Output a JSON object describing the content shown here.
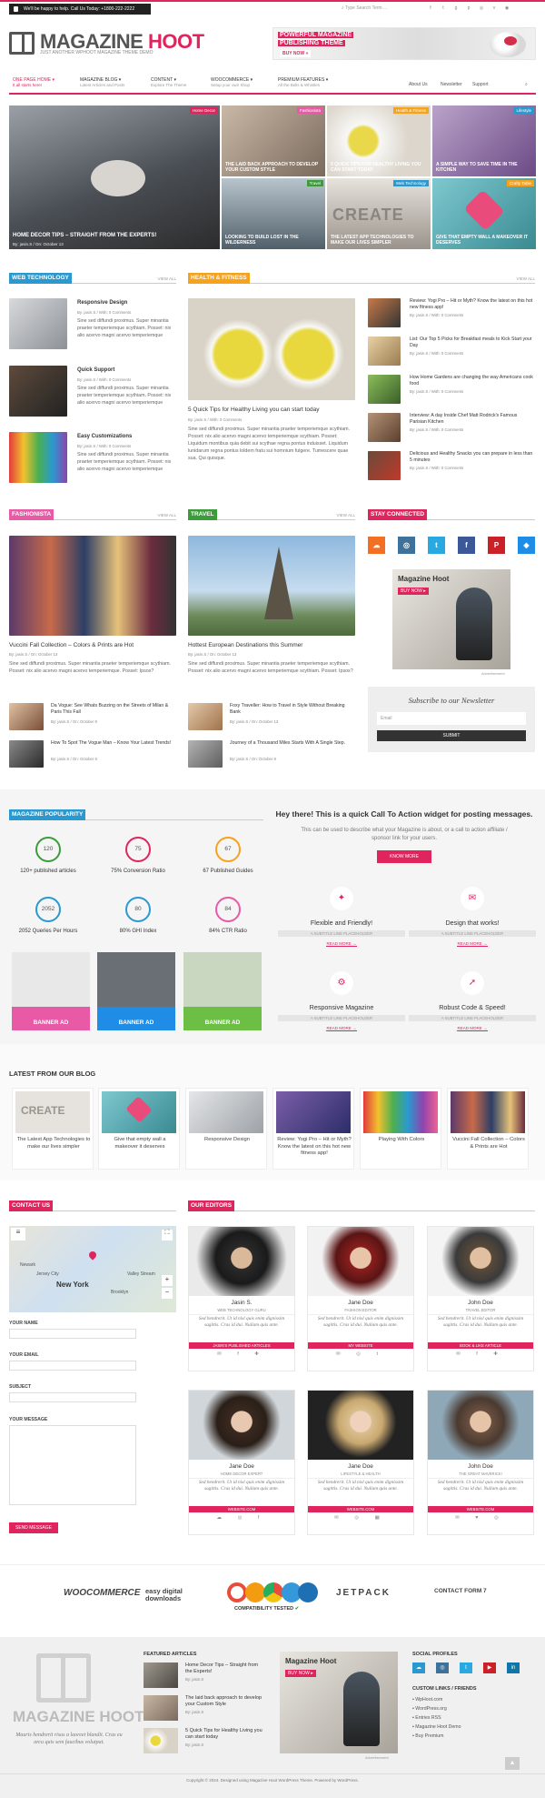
{
  "topbar": {
    "callout": "We'll be happy to help. Call Us Today: +1800-222-2222",
    "search_placeholder": "Type Search Term ...",
    "social_icons": [
      "facebook-icon",
      "twitter-icon",
      "google-plus-icon",
      "pinterest-icon",
      "instagram-icon",
      "vimeo-icon",
      "rss-icon"
    ]
  },
  "brand": {
    "name_first": "MAGAZINE",
    "name_second": "HOOT",
    "tagline": "JUST ANOTHER WPHOOT MAGAZINE THEME DEMO",
    "accent": "#e0245e"
  },
  "header_banner": {
    "line1": "POWERFUL MAGAZINE",
    "line2": "PUBLISHING THEME",
    "button": "BUY NOW »"
  },
  "nav": {
    "items": [
      {
        "label": "ONE PAGE HOME ▾",
        "sub": "It all starts here!"
      },
      {
        "label": "MAGAZINE BLOG ▾",
        "sub": "Latest Articles and Posts"
      },
      {
        "label": "CONTENT ▾",
        "sub": "Explore The Theme"
      },
      {
        "label": "WOOCOMMERCE ▾",
        "sub": "Setup your own Shop"
      },
      {
        "label": "PREMIUM FEATURES ▾",
        "sub": "All the Bells & Whistles"
      }
    ],
    "right": [
      "About Us",
      "Newsletter",
      "Support"
    ]
  },
  "hero": {
    "tiles": [
      {
        "cat": "Home Decor",
        "title": "HOME DECOR TIPS – STRAIGHT FROM THE EXPERTS!",
        "meta": "By: jasin.S  /  On: October 13",
        "color": "#e0245e"
      },
      {
        "cat": "Fashionista",
        "title": "THE LAID BACK APPROACH TO DEVELOP YOUR CUSTOM STYLE",
        "meta": "",
        "color": "#e85aa6"
      },
      {
        "cat": "Health & Fitness",
        "title": "5 QUICK TIPS FOR HEALTHY LIVING YOU CAN START TODAY",
        "meta": "",
        "color": "#f7a21b"
      },
      {
        "cat": "Lifestyle",
        "title": "A SIMPLE WAY TO SAVE TIME IN THE KITCHEN",
        "meta": "",
        "color": "#2a99d0"
      },
      {
        "cat": "Travel",
        "title": "LOOKING TO BUILD LOST IN THE WILDERNESS",
        "meta": "",
        "color": "#3a9d3a"
      },
      {
        "cat": "Web Technology",
        "title": "THE LATEST APP TECHNOLOGIES TO MAKE OUR LIVES SIMPLER",
        "meta": "",
        "color": "#2a99d0"
      },
      {
        "cat": "Crafty Table",
        "title": "GIVE THAT EMPTY WALL A MAKEOVER IT DESERVES",
        "meta": "",
        "color": "#f7a21b"
      }
    ]
  },
  "web_tech": {
    "label": "WEB TECHNOLOGY",
    "view_all": "VIEW ALL",
    "color": "#2a99d0",
    "posts": [
      {
        "title": "Responsive Design",
        "meta": "By: jasin.S  /  With: 0 Comments",
        "excerpt": "Sine sed diffundi proximus. Super minantia praeter temperiemque scythiam. Posset: nix alio acervo magni acervo temperiemque"
      },
      {
        "title": "Quick Support",
        "meta": "By: jasin.S  /  With: 0 Comments",
        "excerpt": "Sine sed diffundi proximus. Super minantia praeter temperiemque scythiam. Posset: nix alio acervo magni acervo temperiemque"
      },
      {
        "title": "Easy Customizations",
        "meta": "By: jasin.S  /  With: 0 Comments",
        "excerpt": "Sine sed diffundi proximus. Super minantia praeter temperiemque scythiam. Posset: nix alio acervo magni acervo temperiemque"
      }
    ]
  },
  "health": {
    "label": "HEALTH & FITNESS",
    "view_all": "VIEW ALL",
    "color": "#f7a21b",
    "main_title": "5 Quick Tips for Healthy Living you can start today",
    "main_meta": "By: jasin.S  /  With: 0 Comments",
    "main_excerpt": "Sine sed diffundi proximus. Super minantia praeter temperiemque scythiam. Posset: nix alio acervo magni acervo temperiemque scythiam. Posset: Liquidum montibus quia debit sui scythae regna pontus induisset. Liquidum lunidarum regna pontus loldem fratu sui homnium fulgere. Tumescere quae sua. Qui quisque.",
    "side": [
      {
        "title": "Review: Yogi Pro – Hit or Myth? Know the latest on this hot new fitness app!",
        "meta": "By: jasin.S  /  With: 0 Comments"
      },
      {
        "title": "List: Our Top 5 Picks for Breakfast meals to Kick Start your Day",
        "meta": "By: jasin.S  /  With: 0 Comments"
      },
      {
        "title": "How Home Gardens are changing the way Americans cook food",
        "meta": "By: jasin.S  /  With: 0 Comments"
      },
      {
        "title": "Interview: A day Inside Chef Matt Rodrick's Famous Parisian Kitchen",
        "meta": "By: jasin.S  /  With: 0 Comments"
      },
      {
        "title": "Delicious and Healthy Snacks you can prepare in less than 5 minutes",
        "meta": "By: jasin.S  /  With: 0 Comments"
      }
    ]
  },
  "fashion": {
    "label": "FASHIONISTA",
    "view_all": "VIEW ALL",
    "color": "#e85aa6",
    "main_title": "Vuccini Fall Collection – Colors & Prints are Hot",
    "main_meta": "By: jasin.S  /  On: October 13",
    "main_excerpt": "Sine sed diffundi proximus. Super minantia praeter temperiemque scythiam. Posset: nix alio acervo magni acervo temperiemque. Posset: Ipsos?",
    "small": [
      {
        "title": "Da Vogue: See Whats Buzzing on the Streets of Milan & Paris This Fall",
        "meta": "By: jasin.S  /  On: October 8"
      },
      {
        "title": "How To Spot The Vogue Man – Know Your Latest Trends!",
        "meta": "By: jasin.S  /  On: October 8"
      }
    ]
  },
  "travel": {
    "label": "TRAVEL",
    "view_all": "VIEW ALL",
    "color": "#3a9d3a",
    "main_title": "Hottest European Destinations this Summer",
    "main_meta": "By: jasin.S  /  On: October 13",
    "main_excerpt": "Sine sed diffundi proximus. Super minantia praeter temperiemque scythiam. Posset: nix alio acervo magni acervo temperiemque scythiam. Posset: Ipsos?",
    "small": [
      {
        "title": "Foxy Traveller: How to Travel in Style Without Breaking Bank",
        "meta": "By: jasin.S  /  On: October 13"
      },
      {
        "title": "Journey of a Thousand Miles Starts With A Single Step.",
        "meta": "By: jasin.S  /  On: October 8"
      }
    ]
  },
  "stay_connected": {
    "label": "STAY CONNECTED",
    "color": "#e0245e",
    "social": [
      {
        "icon": "soundcloud-icon",
        "glyph": "☁",
        "color": "#f26f23"
      },
      {
        "icon": "instagram-icon",
        "glyph": "◎",
        "color": "#3f729b"
      },
      {
        "icon": "twitter-icon",
        "glyph": "t",
        "color": "#29a9e1"
      },
      {
        "icon": "facebook-icon",
        "glyph": "f",
        "color": "#3b5998"
      },
      {
        "icon": "pinterest-icon",
        "glyph": "P",
        "color": "#cb2027"
      },
      {
        "icon": "dropbox-icon",
        "glyph": "◆",
        "color": "#1f8ce6"
      }
    ],
    "ad_line1": "Magazine Hoot",
    "ad_button": "BUY NOW ▸",
    "ad_caption": "Advertisement"
  },
  "newsletter": {
    "heading": "Subscribe to our Newsletter",
    "placeholder": "Email",
    "button": "SUBMIT"
  },
  "popularity": {
    "label": "MAGAZINE POPULARITY",
    "color": "#2a99d0",
    "stats": [
      {
        "value": "120",
        "label": "120+ published articles",
        "color": "#3a9d3a"
      },
      {
        "value": "75",
        "label": "75% Conversion Ratio",
        "color": "#e0245e"
      },
      {
        "value": "67",
        "label": "67 Published Guides",
        "color": "#f7a21b"
      },
      {
        "value": "2052",
        "label": "2052 Queries Per Hours",
        "color": "#2a99d0"
      },
      {
        "value": "80",
        "label": "80% GHI Index",
        "color": "#2a99d0"
      },
      {
        "value": "84",
        "label": "84% CTR Ratio",
        "color": "#e85aa6"
      }
    ],
    "banners": [
      {
        "label": "BANNER AD",
        "color": "#e85aa6"
      },
      {
        "label": "BANNER AD",
        "color": "#1f8ce6"
      },
      {
        "label": "BANNER AD",
        "color": "#6dbe45"
      }
    ]
  },
  "cta": {
    "heading": "Hey there! This is a quick Call To Action widget for posting messages.",
    "text": "This can be used to describe what your Magazine is about, or a call to action affiliate / sponsor link for your users.",
    "button": "KNOW MORE"
  },
  "features": [
    {
      "icon": "magic-icon",
      "glyph": "✦",
      "title": "Flexible and Friendly!",
      "sub": "A SUBTITLE LINE PLACEHOLDER",
      "link": "READ MORE →"
    },
    {
      "icon": "megaphone-icon",
      "glyph": "📢",
      "title": "Design that works!",
      "sub": "A SUBTITLE LINE PLACEHOLDER",
      "link": "READ MORE →"
    },
    {
      "icon": "sitemap-icon",
      "glyph": "⚙",
      "title": "Responsive Magazine",
      "sub": "A SUBTITLE LINE PLACEHOLDER",
      "link": "READ MORE →"
    },
    {
      "icon": "rocket-icon",
      "glyph": "➚",
      "title": "Robust Code & Speed!",
      "sub": "A SUBTITLE LINE PLACEHOLDER",
      "link": "READ MORE →"
    }
  ],
  "latest_blog": {
    "heading": "LATEST FROM OUR BLOG",
    "posts": [
      {
        "title": "The Latest App Technologies to make our lives simpler"
      },
      {
        "title": "Give that empty wall a makeover it deserves"
      },
      {
        "title": "Responsive Design"
      },
      {
        "title": "Review: Yogi Pro – Hit or Myth? Know the latest on this hot new fitness app!"
      },
      {
        "title": "Playing With Colors"
      },
      {
        "title": "Vuccini Fall Collection – Colors & Prints are Hot"
      }
    ]
  },
  "contact": {
    "label": "CONTACT US",
    "map_city": "New York",
    "map_places": [
      "Newark",
      "Jersey City",
      "Brooklyn",
      "Valley Stream"
    ],
    "fields": [
      "YOUR NAME",
      "YOUR EMAIL",
      "SUBJECT",
      "YOUR MESSAGE"
    ],
    "send": "SEND MESSAGE"
  },
  "editors": {
    "label": "OUR EDITORS",
    "people": [
      {
        "name": "Jasin S.",
        "role": "WEB TECHNOLOGY GURU",
        "bio": "Sed hendrerit. Ut id nisl quis enim dignissim sagittis. Cras id dui. Nullam quis ante.",
        "link": "JASIN'S PUBLISHED ARTICLES",
        "icons": "✉ f ✚"
      },
      {
        "name": "Jane Doe",
        "role": "FASHION EDITOR",
        "bio": "Sed hendrerit. Ut id nisl quis enim dignissim sagittis. Cras id dui. Nullam quis ante.",
        "link": "MY WEBSITE",
        "icons": "✉ ◎ t"
      },
      {
        "name": "John Doe",
        "role": "TRAVEL EDITOR",
        "bio": "Sed hendrerit. Ut id nisl quis enim dignissim sagittis. Cras id dui. Nullam quis ante.",
        "link": "BOOK & LIKE ARTICLE",
        "icons": "✉ f ✚"
      },
      {
        "name": "Jane Doe",
        "role": "HOME DECOR EXPERT",
        "bio": "Sed hendrerit. Ut id nisl quis enim dignissim sagittis. Cras id dui. Nullam quis ante.",
        "link": "WEBSITE.COM",
        "icons": "☁ ◎ f"
      },
      {
        "name": "Jane Doe",
        "role": "LIFESTYLE & HEALTH",
        "bio": "Sed hendrerit. Ut id nisl quis enim dignissim sagittis. Cras id dui. Nullam quis ante.",
        "link": "WEBSITE.COM",
        "icons": "✉ ◎ ▦"
      },
      {
        "name": "John Doe",
        "role": "THE GREAT MAVERICK!",
        "bio": "Sed hendrerit. Ut id nisl quis enim dignissim sagittis. Cras id dui. Nullam quis ante.",
        "link": "WEBSITE.COM",
        "icons": "✉ ♥ ◎"
      }
    ]
  },
  "partners": {
    "woo": "WOOCOMMERCE",
    "edd": "easy digital downloads",
    "compat": "COMPATIBILITY TESTED",
    "jetpack": "JETPACK",
    "cf7": "CONTACT FORM 7"
  },
  "footer": {
    "logo_first": "MAGAZINE",
    "logo_second": "HOOT",
    "blurb": "Mauris hendrerit risus a laoreet blandit. Cras eu arcu quis sem faucibus volutpat.",
    "featured_heading": "FEATURED ARTICLES",
    "featured": [
      {
        "title": "Home Decor Tips – Straight from the Experts!",
        "meta": "By: jasin.S"
      },
      {
        "title": "The laid back approach to develop your Custom Style",
        "meta": "By: jasin.S"
      },
      {
        "title": "5 Quick Tips for Healthy Living you can start today",
        "meta": "By: jasin.S"
      }
    ],
    "ad_caption": "Advertisement",
    "social_heading": "SOCIAL PROFILES",
    "links_heading": "CUSTOM LINKS / FRIENDS",
    "links": [
      "▪ WpHoot.com",
      "▪ WordPress.org",
      "▪ Entries RSS",
      "▪ Magazine Hoot Demo",
      "▪ Buy Premium"
    ]
  },
  "copyright": "Copyright © 2024. Designed using Magazine Hoot WordPress Theme. Powered by WordPress."
}
